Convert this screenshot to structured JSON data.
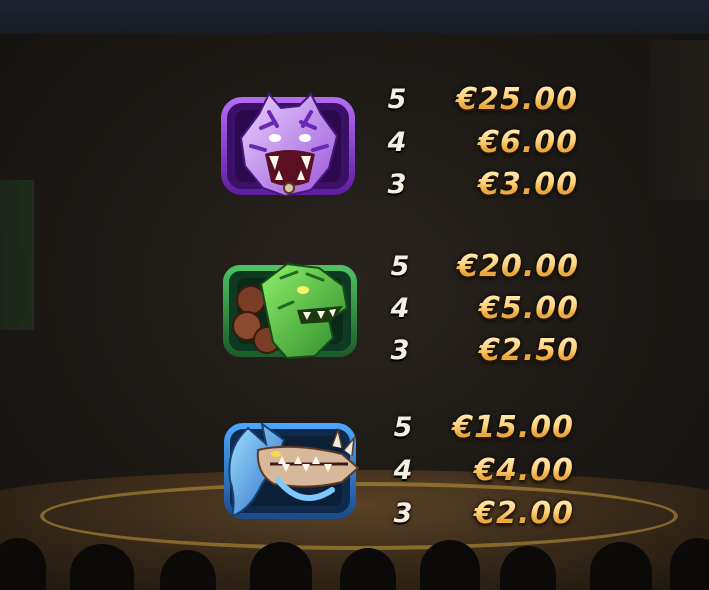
{
  "paytable": [
    {
      "symbol": "purple-tiger-icon",
      "frame_color": "#8a3fd1",
      "payouts": [
        {
          "count": "5",
          "value": "€25.00"
        },
        {
          "count": "4",
          "value": "€6.00"
        },
        {
          "count": "3",
          "value": "€3.00"
        }
      ]
    },
    {
      "symbol": "green-lizard-icon",
      "frame_color": "#2f9a46",
      "payouts": [
        {
          "count": "5",
          "value": "€20.00"
        },
        {
          "count": "4",
          "value": "€5.00"
        },
        {
          "count": "3",
          "value": "€2.50"
        }
      ]
    },
    {
      "symbol": "blue-dragon-icon",
      "frame_color": "#2f7ad1",
      "payouts": [
        {
          "count": "5",
          "value": "€15.00"
        },
        {
          "count": "4",
          "value": "€4.00"
        },
        {
          "count": "3",
          "value": "€2.00"
        }
      ]
    }
  ],
  "colors": {
    "value_gold": "#ffd27a",
    "count_white": "#f4efe2",
    "background": "#1b1713"
  }
}
